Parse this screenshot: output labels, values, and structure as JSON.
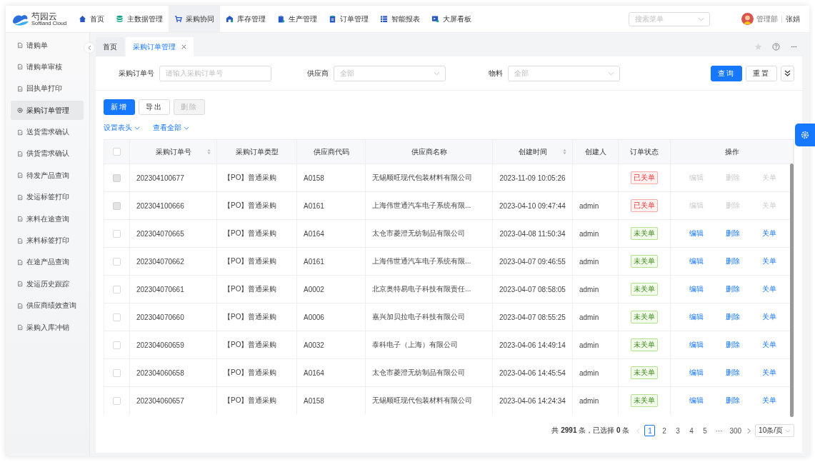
{
  "top_nav": {
    "logo": {
      "name": "芍园云",
      "subtitle": "Softland Cloud"
    },
    "items": [
      {
        "label": "首页",
        "selected": false
      },
      {
        "label": "主数据管理",
        "selected": false
      },
      {
        "label": "采购协同",
        "selected": true
      },
      {
        "label": "库存管理",
        "selected": false
      },
      {
        "label": "生产管理",
        "selected": false
      },
      {
        "label": "订单管理",
        "selected": false
      },
      {
        "label": "智能报表",
        "selected": false
      },
      {
        "label": "大屏看板",
        "selected": false
      }
    ],
    "menu_search": {
      "placeholder": "搜索菜单"
    },
    "user": {
      "department": "管理部",
      "name": "张娟"
    }
  },
  "sidebar": {
    "items": [
      {
        "label": "请购单",
        "selected": false
      },
      {
        "label": "请购单审核",
        "selected": false
      },
      {
        "label": "回执单打印",
        "selected": false
      },
      {
        "label": "采购订单管理",
        "selected": true
      },
      {
        "label": "送货需求确认",
        "selected": false
      },
      {
        "label": "供货需求确认",
        "selected": false
      },
      {
        "label": "待发产品查询",
        "selected": false
      },
      {
        "label": "发运标签打印",
        "selected": false
      },
      {
        "label": "来料在途查询",
        "selected": false
      },
      {
        "label": "来料标签打印",
        "selected": false
      },
      {
        "label": "在途产品查询",
        "selected": false
      },
      {
        "label": "发运历史跟踪",
        "selected": false
      },
      {
        "label": "供应商绩效查询",
        "selected": false
      },
      {
        "label": "采购入库冲销",
        "selected": false
      }
    ]
  },
  "tabs": [
    {
      "label": "首页",
      "selected": false,
      "closable": false
    },
    {
      "label": "采购订单管理",
      "selected": true,
      "closable": true
    }
  ],
  "filters": [
    {
      "label": "采购订单号",
      "kind": "text",
      "placeholder": "请输入采购订单号"
    },
    {
      "label": "供应商",
      "kind": "select",
      "placeholder": "全部"
    },
    {
      "label": "物料",
      "kind": "select",
      "placeholder": "全部"
    }
  ],
  "query_buttons": [
    {
      "label": "查询",
      "kind": "primary"
    },
    {
      "label": "重置",
      "kind": "default"
    }
  ],
  "actions": [
    {
      "label": "新增",
      "kind": "primary",
      "disabled": false
    },
    {
      "label": "导出",
      "kind": "default",
      "disabled": false
    },
    {
      "label": "删除",
      "kind": "default",
      "disabled": true
    }
  ],
  "links": [
    "设置表头",
    "查看全部"
  ],
  "table": {
    "select_all": {
      "checked": false
    },
    "columns": [
      {
        "label": "采购订单号",
        "sortable": true
      },
      {
        "label": "采购订单类型",
        "sortable": false
      },
      {
        "label": "供应商代码",
        "sortable": false
      },
      {
        "label": "供应商名称",
        "sortable": false
      },
      {
        "label": "创建时间",
        "sortable": true
      },
      {
        "label": "创建人",
        "sortable": false
      },
      {
        "label": "订单状态",
        "sortable": false
      },
      {
        "label": "操作",
        "sortable": false
      }
    ],
    "rows": [
      {
        "order_no": "202304100677",
        "order_type": "【PO】普通采购",
        "supplier_code": "A0158",
        "supplier_name": "无锡顺旺现代包装材料有限公司",
        "created_at": "2023-11-09 10:05:26",
        "status": {
          "label": "已关单",
          "kind": "closed"
        },
        "disabled": true,
        "actions": [
          "编辑",
          "删除",
          "关单"
        ]
      },
      {
        "order_no": "202304100666",
        "order_type": "【PO】普通采购",
        "supplier_code": "A0161",
        "supplier_name": "上海伟世通汽车电子系统有限...",
        "created_at": "2023-04-10 09:47:44",
        "creator": "admin",
        "status": {
          "label": "已关单",
          "kind": "closed"
        },
        "disabled": true,
        "actions": [
          "编辑",
          "删除",
          "关单"
        ]
      },
      {
        "order_no": "202304070665",
        "order_type": "【PO】普通采购",
        "supplier_code": "A0164",
        "supplier_name": "太仓市菱澄无纺制品有限公司",
        "created_at": "2023-04-08 11:50:34",
        "creator": "admin",
        "status": {
          "label": "未关单",
          "kind": "open"
        },
        "disabled": false,
        "actions": [
          "编辑",
          "删除",
          "关单"
        ]
      },
      {
        "order_no": "202304070662",
        "order_type": "【PO】普通采购",
        "supplier_code": "A0161",
        "supplier_name": "上海伟世通汽车电子系统有限...",
        "created_at": "2023-04-07 09:46:55",
        "creator": "admin",
        "status": {
          "label": "未关单",
          "kind": "open"
        },
        "disabled": false,
        "actions": [
          "编辑",
          "删除",
          "关单"
        ]
      },
      {
        "order_no": "202304070661",
        "order_type": "【PO】普通采购",
        "supplier_code": "A0002",
        "supplier_name": "北京奥特易电子科技有限责任...",
        "created_at": "2023-04-07 08:58:05",
        "creator": "admin",
        "status": {
          "label": "未关单",
          "kind": "open"
        },
        "disabled": false,
        "actions": [
          "编辑",
          "删除",
          "关单"
        ]
      },
      {
        "order_no": "202304070660",
        "order_type": "【PO】普通采购",
        "supplier_code": "A0006",
        "supplier_name": "嘉兴加贝拉电子科技有限公司",
        "created_at": "2023-04-07 08:55:25",
        "creator": "admin",
        "status": {
          "label": "未关单",
          "kind": "open"
        },
        "disabled": false,
        "actions": [
          "编辑",
          "删除",
          "关单"
        ]
      },
      {
        "order_no": "202304060659",
        "order_type": "【PO】普通采购",
        "supplier_code": "A0032",
        "supplier_name": "泰科电子（上海）有限公司",
        "created_at": "2023-04-06 14:49:14",
        "creator": "admin",
        "status": {
          "label": "未关单",
          "kind": "open"
        },
        "disabled": false,
        "actions": [
          "编辑",
          "删除",
          "关单"
        ]
      },
      {
        "order_no": "202304060658",
        "order_type": "【PO】普通采购",
        "supplier_code": "A0164",
        "supplier_name": "太仓市菱澄无纺制品有限公司",
        "created_at": "2023-04-06 14:45:54",
        "creator": "admin",
        "status": {
          "label": "未关单",
          "kind": "open"
        },
        "disabled": false,
        "actions": [
          "编辑",
          "删除",
          "关单"
        ]
      },
      {
        "order_no": "202304060657",
        "order_type": "【PO】普通采购",
        "supplier_code": "A0158",
        "supplier_name": "无锡顺旺现代包装材料有限公司",
        "created_at": "2023-04-06 14:24:34",
        "creator": "admin",
        "status": {
          "label": "未关单",
          "kind": "open"
        },
        "disabled": false,
        "actions": [
          "编辑",
          "删除",
          "关单"
        ]
      }
    ]
  },
  "pagination": {
    "summary": "共 **2991** 条，已选择 **0** 条",
    "pages": [
      {
        "label": "1",
        "selected": true
      },
      {
        "label": "2",
        "selected": false
      },
      {
        "label": "3",
        "selected": false
      },
      {
        "label": "4",
        "selected": false
      },
      {
        "label": "5",
        "selected": false
      },
      {
        "label": "···",
        "selected": false
      },
      {
        "label": "300",
        "selected": false
      }
    ],
    "page_size": "10条/页"
  }
}
